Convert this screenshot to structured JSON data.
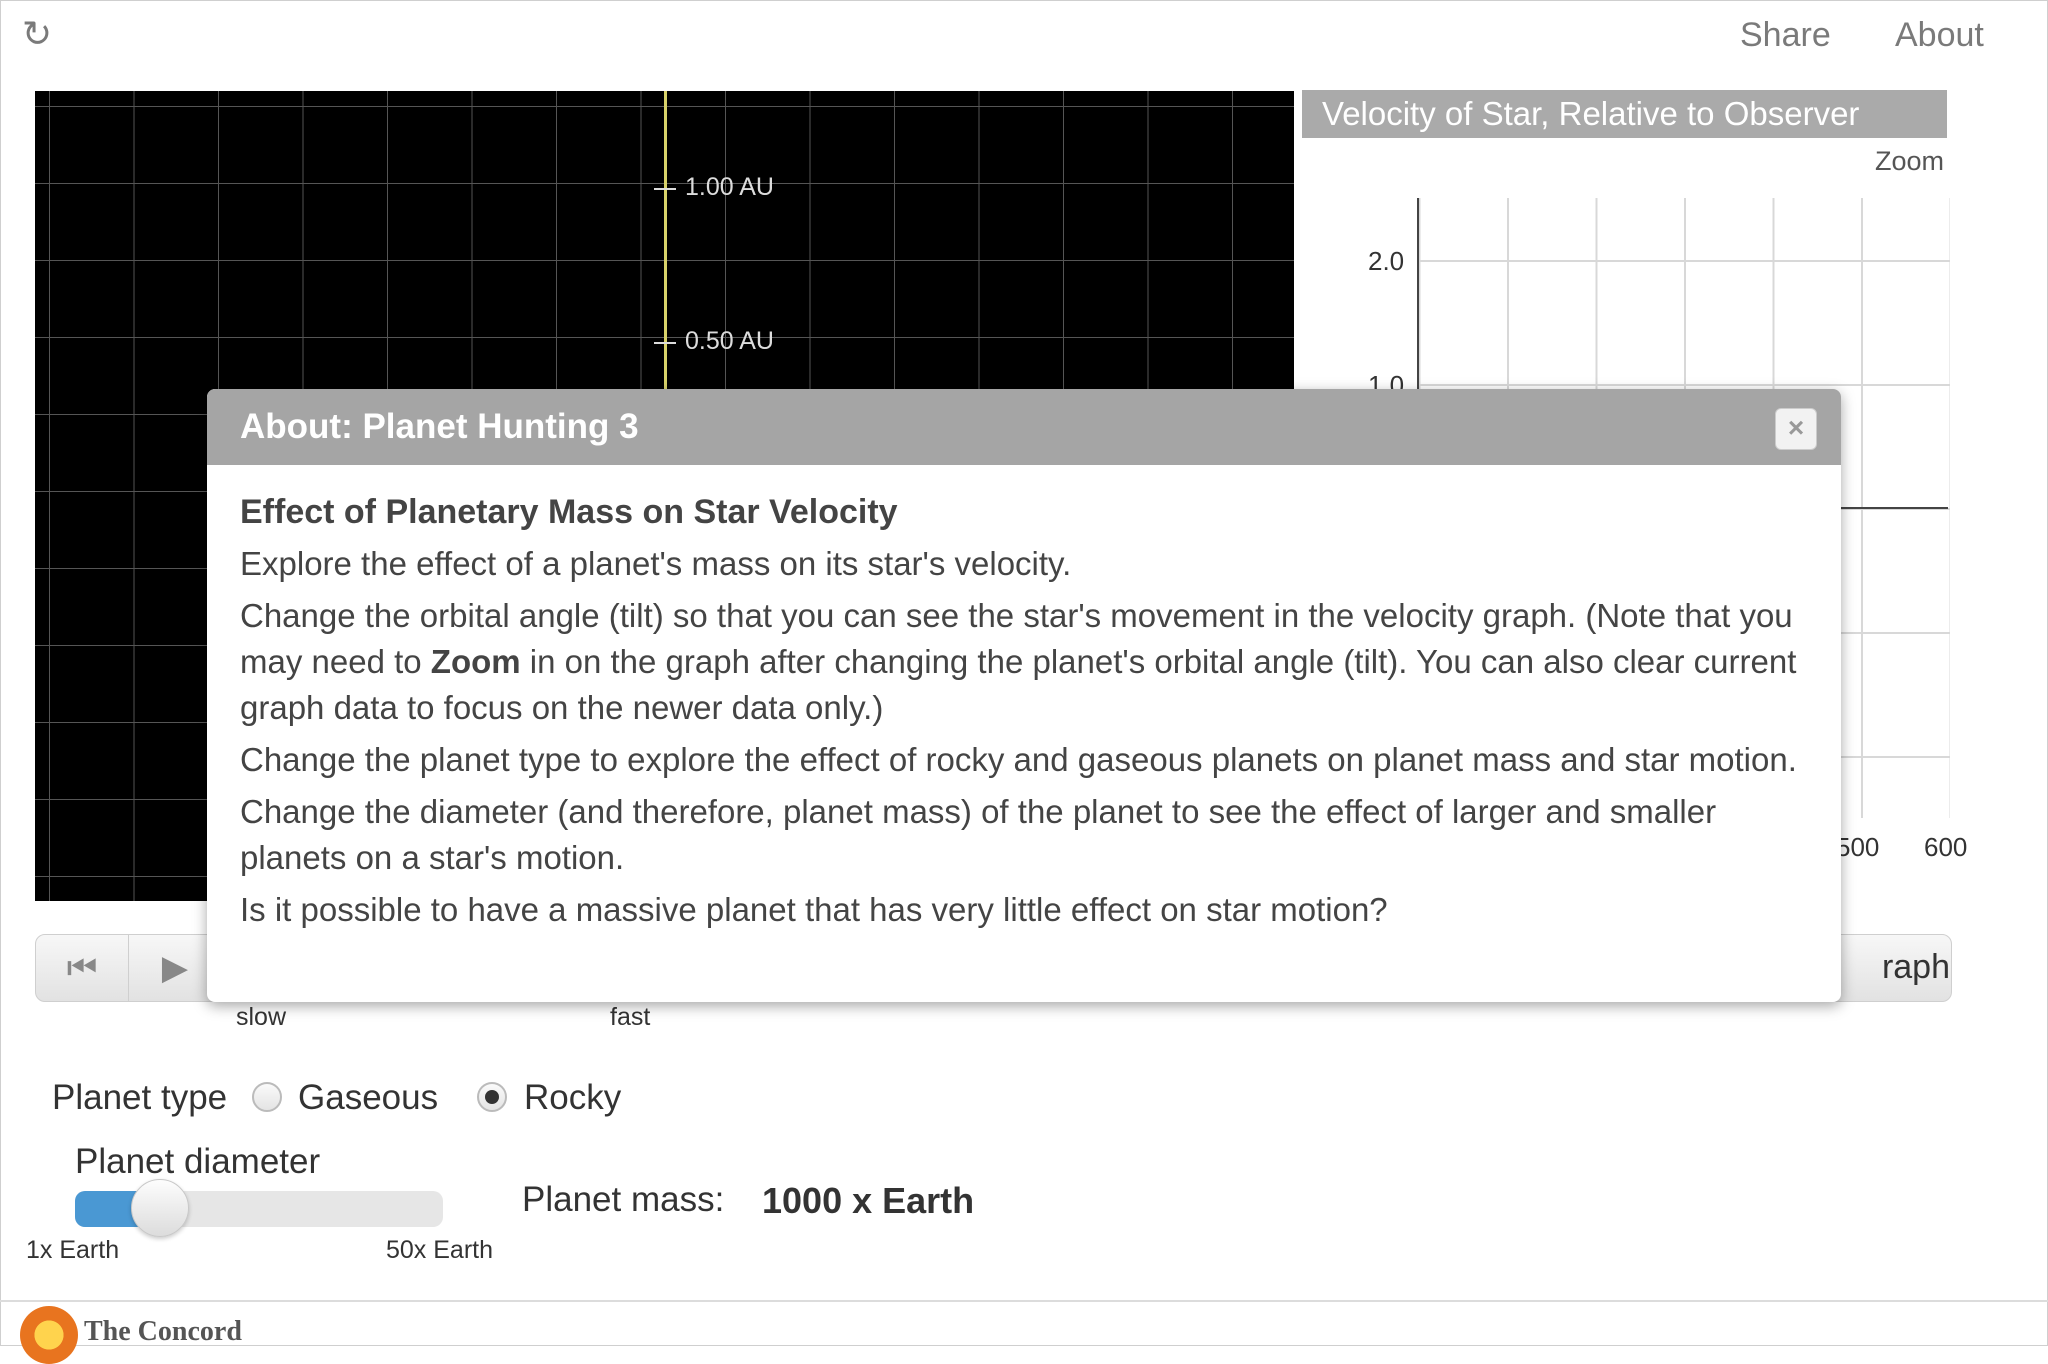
{
  "topbar": {
    "reload_icon": "reload-icon",
    "share": "Share",
    "about": "About"
  },
  "orbit": {
    "au_labels": [
      "1.00 AU",
      "0.50 AU"
    ],
    "axis_color": "#d8d26a"
  },
  "graph": {
    "title": "Velocity of Star, Relative to Observer",
    "zoom": "Zoom",
    "y_ticks": [
      "2.0",
      "1.0"
    ],
    "x_ticks": [
      "500",
      "600"
    ],
    "button_partial": "raph"
  },
  "controls": {
    "rewind_icon": "rewind-icon",
    "play_icon": "play-icon",
    "slow": "slow",
    "fast": "fast"
  },
  "planet": {
    "type_label": "Planet type",
    "options": [
      "Gaseous",
      "Rocky"
    ],
    "selected": "Rocky",
    "diameter_label": "Planet diameter",
    "slider_min": "1x Earth",
    "slider_max": "50x Earth",
    "slider_fraction": 0.2,
    "mass_label": "Planet mass:",
    "mass_value": "1000 x Earth",
    "accent": "#4a98d3"
  },
  "footer": {
    "logo_text": "The Concord"
  },
  "dialog": {
    "title": "About: Planet Hunting 3",
    "close": "×",
    "heading": "Effect of Planetary Mass on Star Velocity",
    "p1": "Explore the effect of a planet's mass on its star's velocity.",
    "p2_a": "Change the orbital angle (tilt) so that you can see the star's movement in the velocity graph. (Note that you may need to ",
    "p2_bold": "Zoom",
    "p2_b": " in on the graph after changing the planet's orbital angle (tilt). You can also clear current graph data to focus on the newer data only.)",
    "p3": "Change the planet type to explore the effect of rocky and gaseous planets on planet mass and star motion.",
    "p4": "Change the diameter (and therefore, planet mass) of the planet to see the effect of larger and smaller planets on a star's motion.",
    "p5": "Is it possible to have a massive planet that has very little effect on star motion?"
  }
}
